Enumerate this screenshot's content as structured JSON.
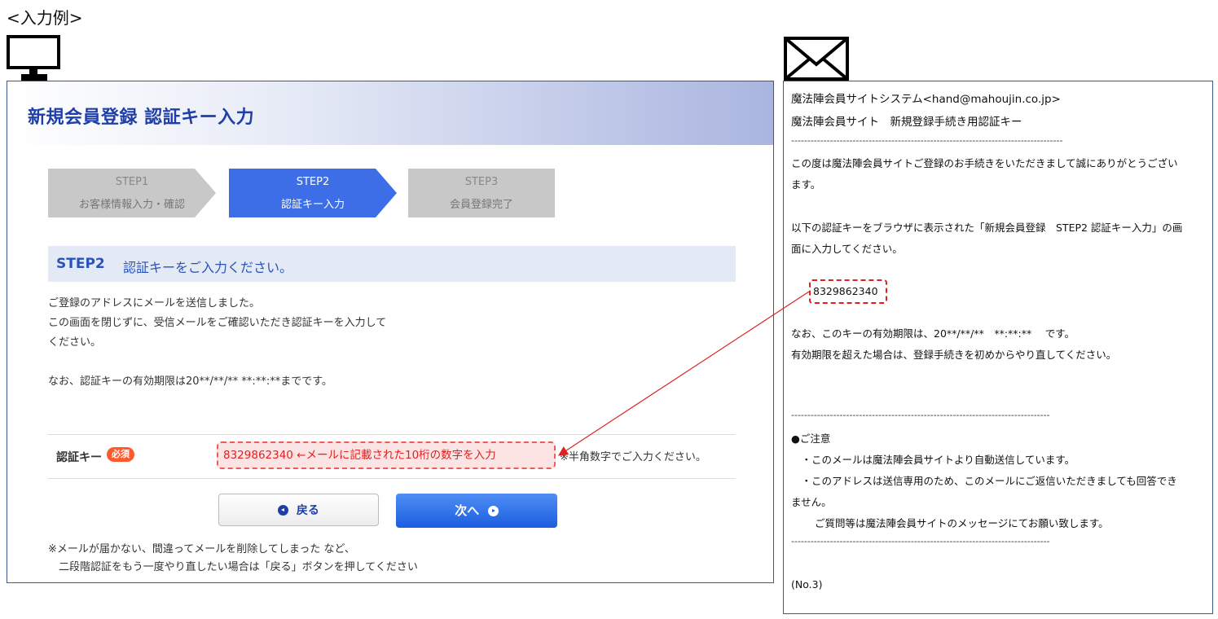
{
  "caption": "<入力例>",
  "icons": {
    "monitor": "monitor-icon",
    "mail": "envelope-icon",
    "back": "circle-arrow-left-icon",
    "next": "circle-arrow-right-icon"
  },
  "screen": {
    "title": "新規会員登録 認証キー入力",
    "steps": [
      {
        "num": "STEP1",
        "label": "お客様情報入力・確認",
        "active": false
      },
      {
        "num": "STEP2",
        "label": "認証キー入力",
        "active": true
      },
      {
        "num": "STEP3",
        "label": "会員登録完了",
        "active": false
      }
    ],
    "section_step": "STEP2",
    "section_title": "認証キーをご入力ください。",
    "para1": [
      "ご登録のアドレスにメールを送信しました。",
      "この画面を閉じずに、受信メールをご確認いただき認証キーを入力して",
      "ください。"
    ],
    "para2": "なお、認証キーの有効期限は20**/**/** **:**:**までです。",
    "form": {
      "label": "認証キー",
      "required": "必須",
      "input_value": "8329862340 ←メールに記載された10桁の数字を入力",
      "note": "※半角数字でご入力ください。"
    },
    "back_label": "戻る",
    "next_label": "次へ",
    "footnote": [
      "※メールが届かない、間違ってメールを削除してしまった など、",
      "　二段階認証をもう一度やり直したい場合は「戻る」ボタンを押してください"
    ]
  },
  "mail": {
    "from": "魔法陣会員サイトシステム<hand@mahoujin.co.jp>",
    "subject": "魔法陣会員サイト　新規登録手続き用認証キー",
    "rule": "------------------------------------------------------------------------------------",
    "body1": [
      "この度は魔法陣会員サイトご登録のお手続きをいただきまして誠にありがとうござい",
      "ます。"
    ],
    "body2": [
      "以下の認証キーをブラウザに表示された「新規会員登録　STEP2 認証キー入力」の画",
      "面に入力してください。"
    ],
    "key": "8329862340",
    "expiry": [
      "なお、このキーの有効期限は、20**/**/**　**:**:**　 です。",
      "有効期限を超えた場合は、登録手続きを初めからやり直してください。"
    ],
    "rule2": "--------------------------------------------------------------------------------",
    "notice_head": "●ご注意",
    "notice": [
      "　・このメールは魔法陣会員サイトより自動送信しています。",
      "　・このアドレスは送信専用のため、このメールにご返信いただきましても回答でき",
      "ません。",
      "　　 ご質問等は魔法陣会員サイトのメッセージにてお願い致します。"
    ],
    "rule3": "--------------------------------------------------------------------------------",
    "no": "(No.3)"
  }
}
